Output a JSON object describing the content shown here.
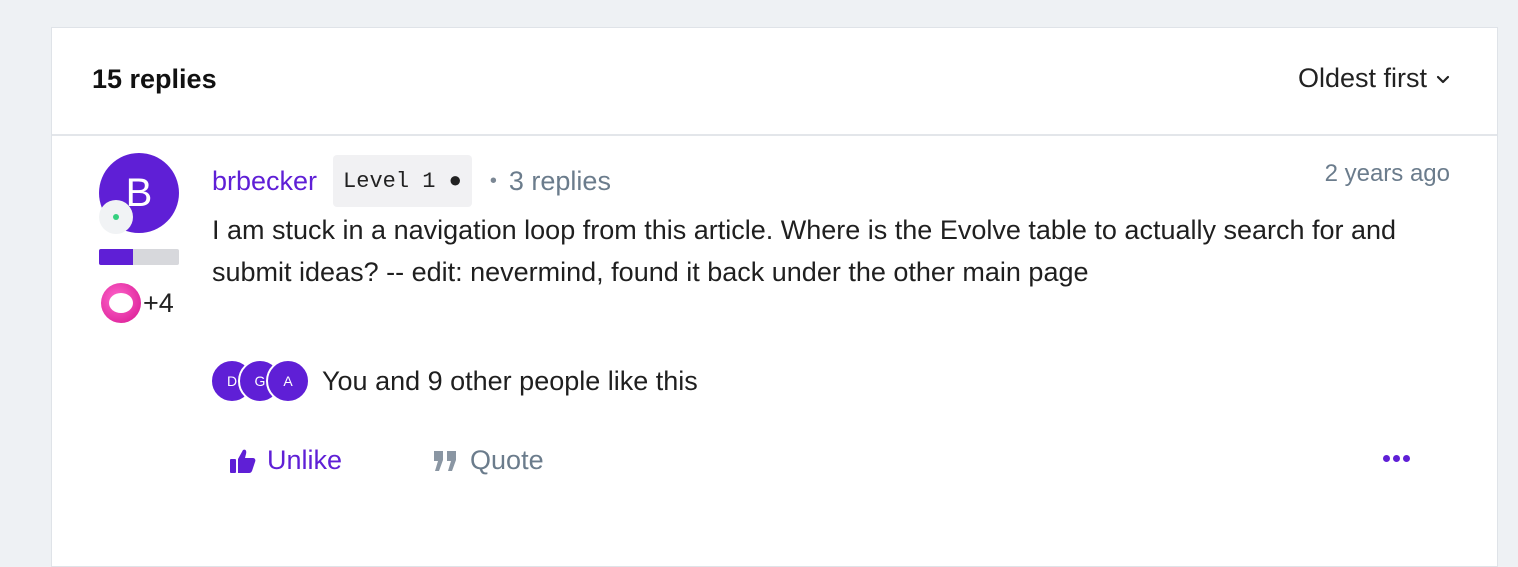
{
  "thread": {
    "replies_label": "15 replies",
    "sort_label": "Oldest first"
  },
  "post": {
    "avatar_letter": "B",
    "rank_progress_percent": 42,
    "badge_extra": "+4",
    "username": "brbecker",
    "level": "Level 1 ●",
    "separator": "•",
    "reply_count": "3 replies",
    "timestamp": "2 years ago",
    "body": "I am stuck in a navigation loop from this article. Where is the Evolve table to actually search for and submit ideas? -- edit: nevermind, found it back under the other main page",
    "likers": [
      "D",
      "G",
      "A"
    ],
    "likes_text": "You and 9 other people like this",
    "unlike_label": "Unlike",
    "quote_label": "Quote"
  },
  "colors": {
    "accent": "#5f1fd6",
    "muted": "#6b7c8c",
    "background": "#eef1f4",
    "online": "#35d07f",
    "badge": "#d6148f"
  },
  "icons": {
    "sort": "chevron-down-icon",
    "unlike": "thumbs-up-icon",
    "quote": "quote-icon",
    "more": "ellipsis-icon",
    "badge": "speech-bubble-icon"
  }
}
